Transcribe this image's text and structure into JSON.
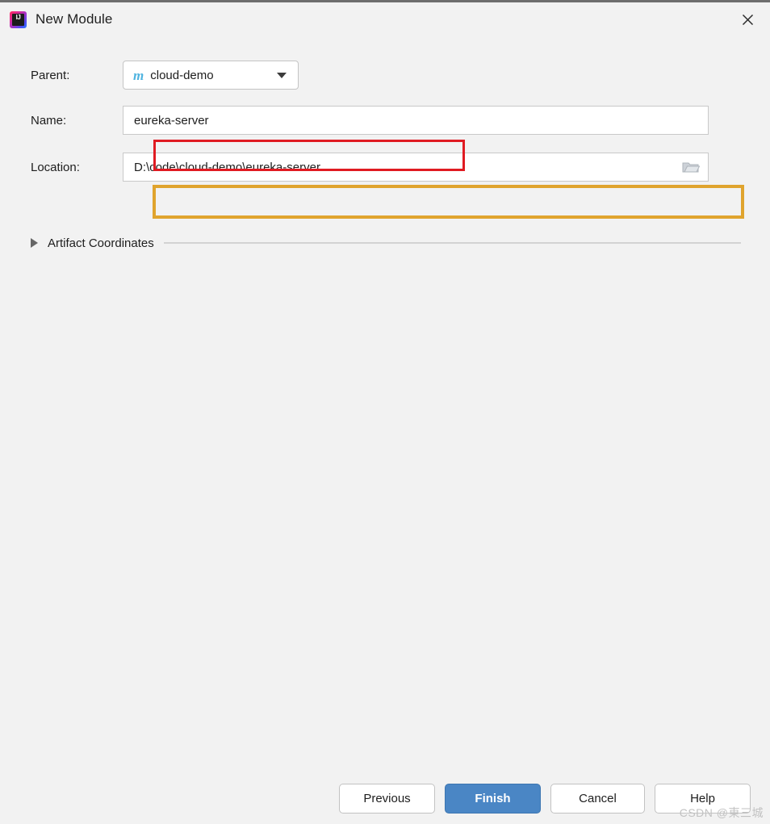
{
  "window": {
    "title": "New Module",
    "app_icon": "intellij-idea-icon",
    "icon_letters": "IJ",
    "close_label": "✕"
  },
  "form": {
    "parent": {
      "label": "Parent:",
      "value": "cloud-demo",
      "icon": "maven-module-icon",
      "icon_glyph": "m",
      "icon_color": "#4fb4e0",
      "caret": "chevron-down-icon"
    },
    "name": {
      "label": "Name:",
      "value": "eureka-server",
      "placeholder": "",
      "highlight_color": "#e01b22"
    },
    "location": {
      "label": "Location:",
      "value": "D:\\code\\cloud-demo\\eureka-server",
      "placeholder": "",
      "browse_icon": "folder-icon",
      "highlight_color": "#e0a42e"
    },
    "artifact_coordinates": {
      "label": "Artifact Coordinates",
      "expanded": false,
      "toggle_icon": "triangle-right-icon"
    }
  },
  "footer": {
    "previous_label": "Previous",
    "finish_label": "Finish",
    "cancel_label": "Cancel",
    "help_label": "Help",
    "primary_color": "#4a86c5"
  },
  "watermark": {
    "text": "CSDN @東三城"
  }
}
